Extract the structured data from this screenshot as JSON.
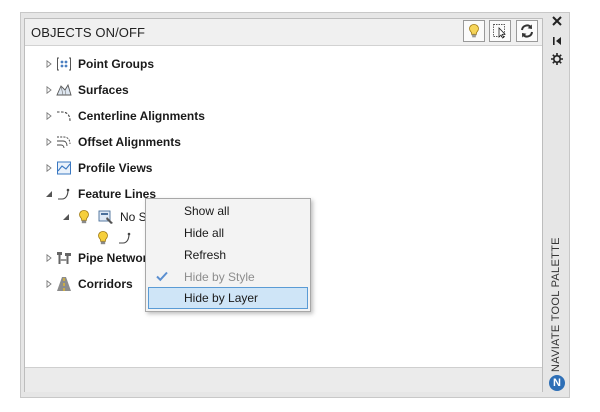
{
  "panel": {
    "title": "OBJECTS ON/OFF",
    "header_buttons": [
      {
        "icon": "lightbulb-icon"
      },
      {
        "icon": "select-cursor-icon"
      },
      {
        "icon": "refresh-icon"
      }
    ]
  },
  "palette": {
    "title": "NAVIATE TOOL PALETTE",
    "logo_letter": "N",
    "buttons": [
      {
        "icon": "close-icon"
      },
      {
        "icon": "pin-icon"
      },
      {
        "icon": "settings-icon"
      }
    ]
  },
  "tree": {
    "items": [
      {
        "label": "Point Groups",
        "icon": "point-groups-icon",
        "expanded": false
      },
      {
        "label": "Surfaces",
        "icon": "surfaces-icon",
        "expanded": false
      },
      {
        "label": "Centerline Alignments",
        "icon": "centerline-alignment-icon",
        "expanded": false
      },
      {
        "label": "Offset Alignments",
        "icon": "offset-alignment-icon",
        "expanded": false
      },
      {
        "label": "Profile Views",
        "icon": "profile-views-icon",
        "expanded": false
      },
      {
        "label": "Feature Lines",
        "icon": "feature-line-icon",
        "expanded": true
      },
      {
        "label": "Pipe Networ",
        "icon": "pipe-network-icon",
        "expanded": false
      },
      {
        "label": "Corridors",
        "icon": "corridors-icon",
        "expanded": false
      }
    ],
    "child": {
      "label": "No S",
      "icons": [
        "lightbulb-icon",
        "style-icon"
      ]
    },
    "grandchild": {
      "icons": [
        "lightbulb-icon",
        "feature-line-icon"
      ]
    }
  },
  "context_menu": {
    "items": [
      {
        "label": "Show all",
        "enabled": true,
        "checked": false,
        "highlighted": false
      },
      {
        "label": "Hide all",
        "enabled": true,
        "checked": false,
        "highlighted": false
      },
      {
        "label": "Refresh",
        "enabled": true,
        "checked": false,
        "highlighted": false
      },
      {
        "label": "Hide by Style",
        "enabled": false,
        "checked": true,
        "highlighted": false
      },
      {
        "label": "Hide by Layer",
        "enabled": true,
        "checked": false,
        "highlighted": true
      }
    ]
  },
  "colors": {
    "highlight": "#cfe5f7",
    "highlight_border": "#5a9bd5",
    "logo": "#2e6fb6"
  }
}
